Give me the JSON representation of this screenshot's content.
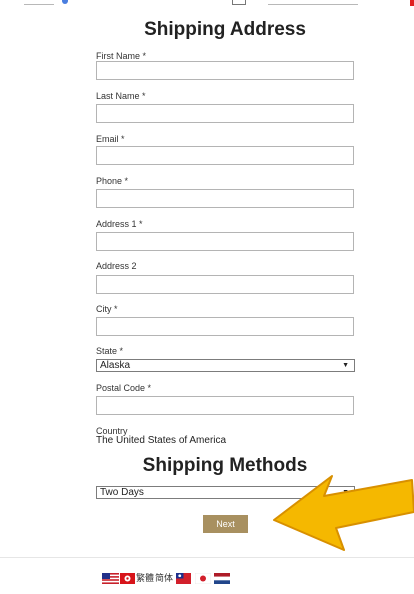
{
  "shipping_address": {
    "heading": "Shipping Address",
    "fields": [
      {
        "label": "First Name *",
        "value": ""
      },
      {
        "label": "Last Name *",
        "value": ""
      },
      {
        "label": "Email *",
        "value": ""
      },
      {
        "label": "Phone *",
        "value": ""
      },
      {
        "label": "Address 1 *",
        "value": ""
      },
      {
        "label": "Address 2",
        "value": ""
      },
      {
        "label": "City *",
        "value": ""
      }
    ],
    "state": {
      "label": "State *",
      "selected": "Alaska"
    },
    "postal_code": {
      "label": "Postal Code *",
      "value": ""
    },
    "country": {
      "label": "Country",
      "value": "The United States of America"
    }
  },
  "shipping_methods": {
    "heading": "Shipping Methods",
    "selected": "Two Days"
  },
  "next_button": {
    "label": "Next"
  },
  "languages": {
    "traditional_chinese_label": "繁體",
    "simplified_chinese_label": "简体"
  },
  "colors": {
    "accent": "#a89060",
    "pointer_arrow": "#f5b800"
  },
  "icons": {
    "pointer": "arrow-pointer-icon",
    "dropdown": "chevron-down-icon"
  }
}
